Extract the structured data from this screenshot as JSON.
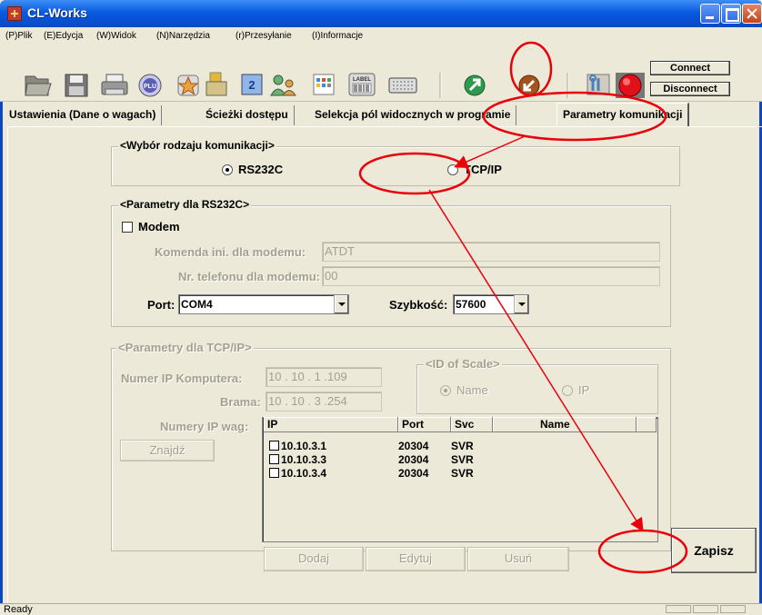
{
  "window": {
    "title": "CL-Works"
  },
  "menu": [
    "(P)Plik",
    "(E)Edycja",
    "(W)Widok",
    "(N)Narzędzia",
    "(r)Przesyłanie",
    "(I)Informacje"
  ],
  "toolbar": {
    "icons": [
      "open-folder-icon",
      "save-disk-icon",
      "print-icon",
      "plu-icon",
      "star-icon",
      "scale-icon",
      "label-user-icon",
      "people-icon",
      "barcode-icon",
      "label-icon",
      "keyboard-icon",
      "send-icon",
      "receive-icon",
      "tools-icon",
      "record-icon"
    ],
    "plu_text": "PLU",
    "label_text": "LABEL",
    "connect_label": "Connect",
    "disconnect_label": "Disconnect"
  },
  "tabs": [
    {
      "label": "Ustawienia (Dane o wagach)",
      "active": false
    },
    {
      "label": "Ścieżki dostępu",
      "active": false
    },
    {
      "label": "Selekcja pól widocznych w programie",
      "active": false
    },
    {
      "label": "Parametry komunikacji",
      "active": true
    }
  ],
  "comm_type": {
    "legend": "<Wybór rodzaju komunikacji>",
    "option_rs232": "RS232C",
    "option_tcpip": "TCP/IP",
    "selected": "RS232C"
  },
  "rs232": {
    "legend": "<Parametry dla RS232C>",
    "modem_label": "Modem",
    "modem_checked": false,
    "init_cmd_label": "Komenda ini. dla modemu:",
    "init_cmd_value": "ATDT",
    "phone_label": "Nr. telefonu dla modemu:",
    "phone_value": "00",
    "port_label": "Port:",
    "port_value": "COM4",
    "speed_label": "Szybkość:",
    "speed_value": "57600"
  },
  "tcpip": {
    "legend": "<Parametry dla TCP/IP>",
    "computer_ip_label": "Numer IP Komputera:",
    "computer_ip_value": "10 . 10 . 1 .109",
    "gateway_label": "Brama:",
    "gateway_value": "10 . 10 . 3 .254",
    "scale_ip_label": "Numery IP wag:",
    "find_button": "Znajdź",
    "scale_id_legend": "<ID of Scale>",
    "scale_id_name": "Name",
    "scale_id_ip": "IP",
    "scale_id_selected": "Name",
    "table_headers": [
      "IP",
      "Port",
      "Svc",
      "Name"
    ],
    "rows": [
      {
        "ip": "10.10.3.1",
        "port": "20304",
        "svc": "SVR",
        "name": ""
      },
      {
        "ip": "10.10.3.3",
        "port": "20304",
        "svc": "SVR",
        "name": ""
      },
      {
        "ip": "10.10.3.4",
        "port": "20304",
        "svc": "SVR",
        "name": ""
      }
    ],
    "add_button": "Dodaj",
    "edit_button": "Edytuj",
    "delete_button": "Usuń"
  },
  "save_button": "Zapisz",
  "status": {
    "text": "Ready"
  },
  "colors": {
    "annotation": "#e8000b",
    "titlebar": "#0a5ae0"
  }
}
